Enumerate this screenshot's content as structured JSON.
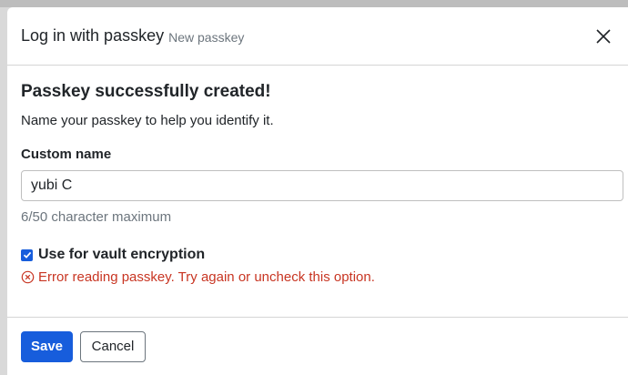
{
  "dialog": {
    "title": "Log in with passkey",
    "subtitle": "New passkey",
    "close_icon": "close-icon"
  },
  "content": {
    "heading": "Passkey successfully created!",
    "instruction": "Name your passkey to help you identify it.",
    "name_field": {
      "label": "Custom name",
      "value": "yubi C",
      "hint": "6/50 character maximum"
    },
    "encryption_checkbox": {
      "label": "Use for vault encryption",
      "checked": true
    },
    "error": {
      "icon": "error-circle-icon",
      "message": "Error reading passkey. Try again or uncheck this option."
    }
  },
  "footer": {
    "save_label": "Save",
    "cancel_label": "Cancel"
  },
  "colors": {
    "primary": "#175ddc",
    "error": "#c83522",
    "muted": "#6c757d"
  }
}
